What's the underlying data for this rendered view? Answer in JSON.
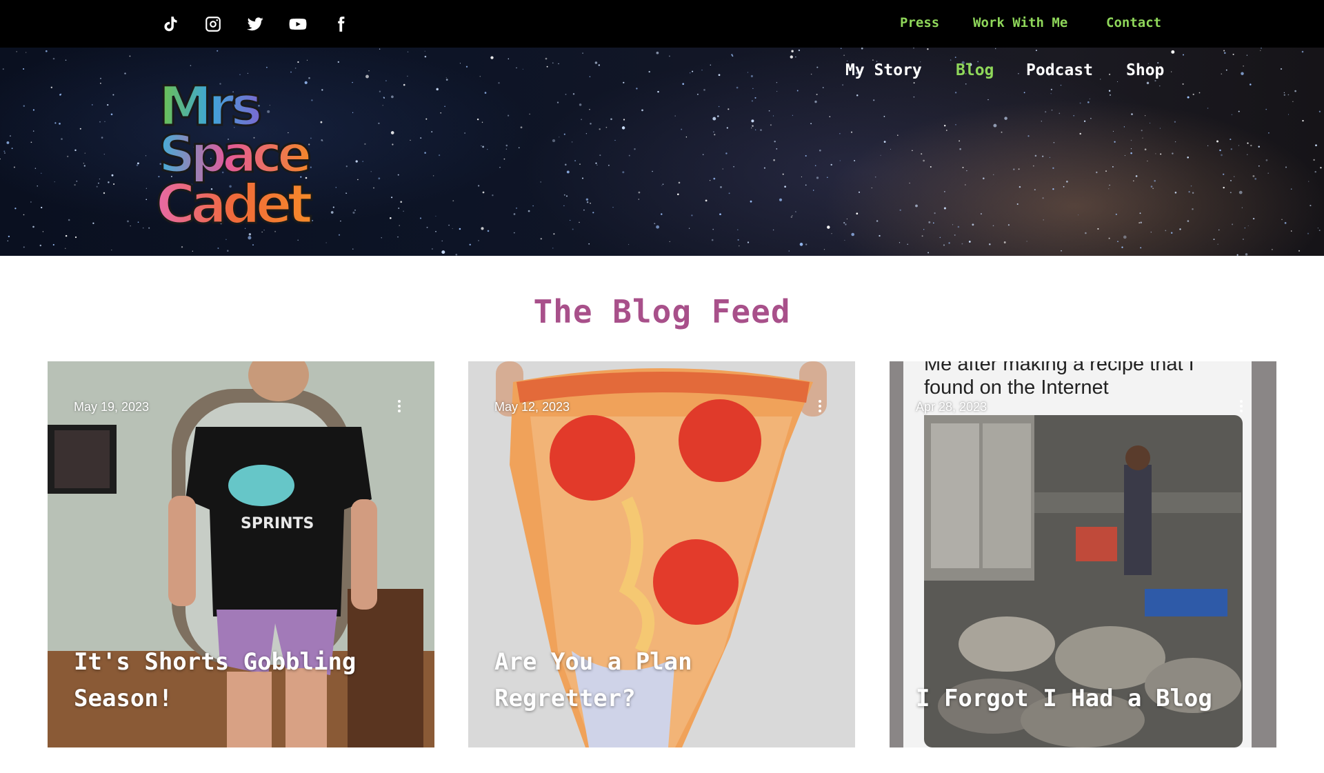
{
  "topbar": {
    "social_icons": [
      "tiktok-icon",
      "instagram-icon",
      "twitter-icon",
      "youtube-icon",
      "facebook-icon"
    ],
    "links": [
      "Press",
      "Work With Me",
      "Contact"
    ],
    "link_color": "#8fd75a"
  },
  "header": {
    "logo": {
      "lines": [
        "Mrs",
        "Space",
        "Cadet"
      ]
    },
    "nav": [
      {
        "label": "My Story",
        "active": false
      },
      {
        "label": "Blog",
        "active": true
      },
      {
        "label": "Podcast",
        "active": false
      },
      {
        "label": "Shop",
        "active": false
      }
    ],
    "active_color": "#8fd75a"
  },
  "feed": {
    "title": "The Blog Feed",
    "title_color": "#a8508a",
    "posts": [
      {
        "date": "May 19, 2023",
        "title": "It's Shorts Gobbling Season!",
        "image": "woman-in-sprints-tshirt-photo"
      },
      {
        "date": "May 12, 2023",
        "title": "Are You a Plan Regretter?",
        "image": "pizza-costume-photo"
      },
      {
        "date": "Apr 28, 2023",
        "title": "I Forgot I Had a Blog",
        "image": "messy-kitchen-meme",
        "meme_text": [
          "Me after making a recipe that I",
          "found on the Internet"
        ]
      }
    ]
  }
}
